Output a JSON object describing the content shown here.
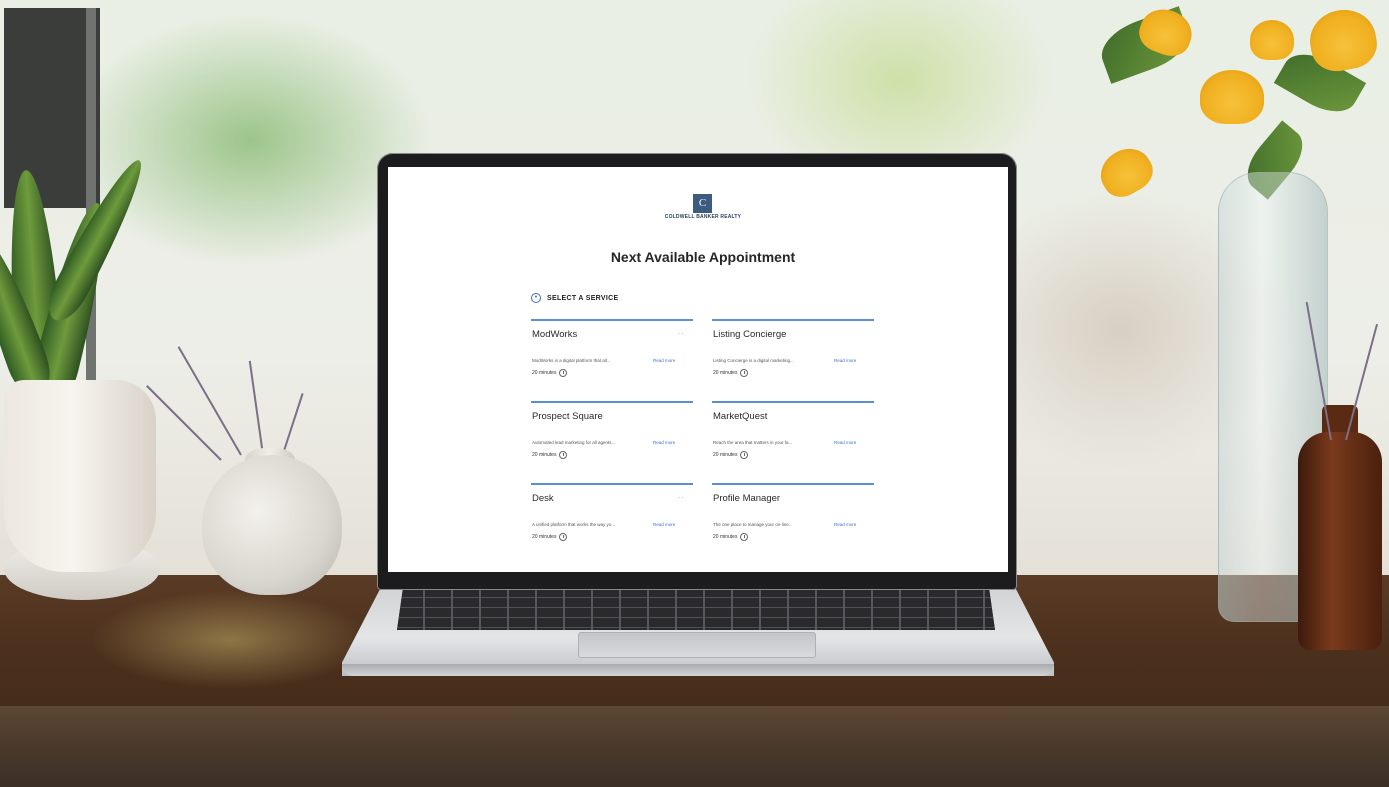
{
  "page": {
    "logo_glyph": "C",
    "logo_text": "COLDWELL BANKER REALTY",
    "title": "Next Available Appointment"
  },
  "step": {
    "icon": "clock-icon",
    "label": "SELECT A SERVICE"
  },
  "services": [
    {
      "title": "ModWorks",
      "description": "ModWorks is a digital platform that all...",
      "read_more": "Read more",
      "duration": "20 minutes"
    },
    {
      "title": "Listing Concierge",
      "description": "Listing Concierge is a digital marketing...",
      "read_more": "Read more",
      "duration": "20 minutes"
    },
    {
      "title": "Prospect Square",
      "description": "Automated lead marketing for all agents...",
      "read_more": "Read more",
      "duration": "20 minutes"
    },
    {
      "title": "MarketQuest",
      "description": "Reach the area that matters in your fa...",
      "read_more": "Read more",
      "duration": "20 minutes"
    },
    {
      "title": "Desk",
      "description": "A unified platform that works the way yo...",
      "read_more": "Read more",
      "duration": "20 minutes"
    },
    {
      "title": "Profile Manager",
      "description": "The one place to manage your on-line...",
      "read_more": "Read more",
      "duration": "20 minutes"
    }
  ],
  "colors": {
    "accent": "#5a8fd6",
    "logo": "#3d5a80",
    "link": "#3b73c6"
  }
}
